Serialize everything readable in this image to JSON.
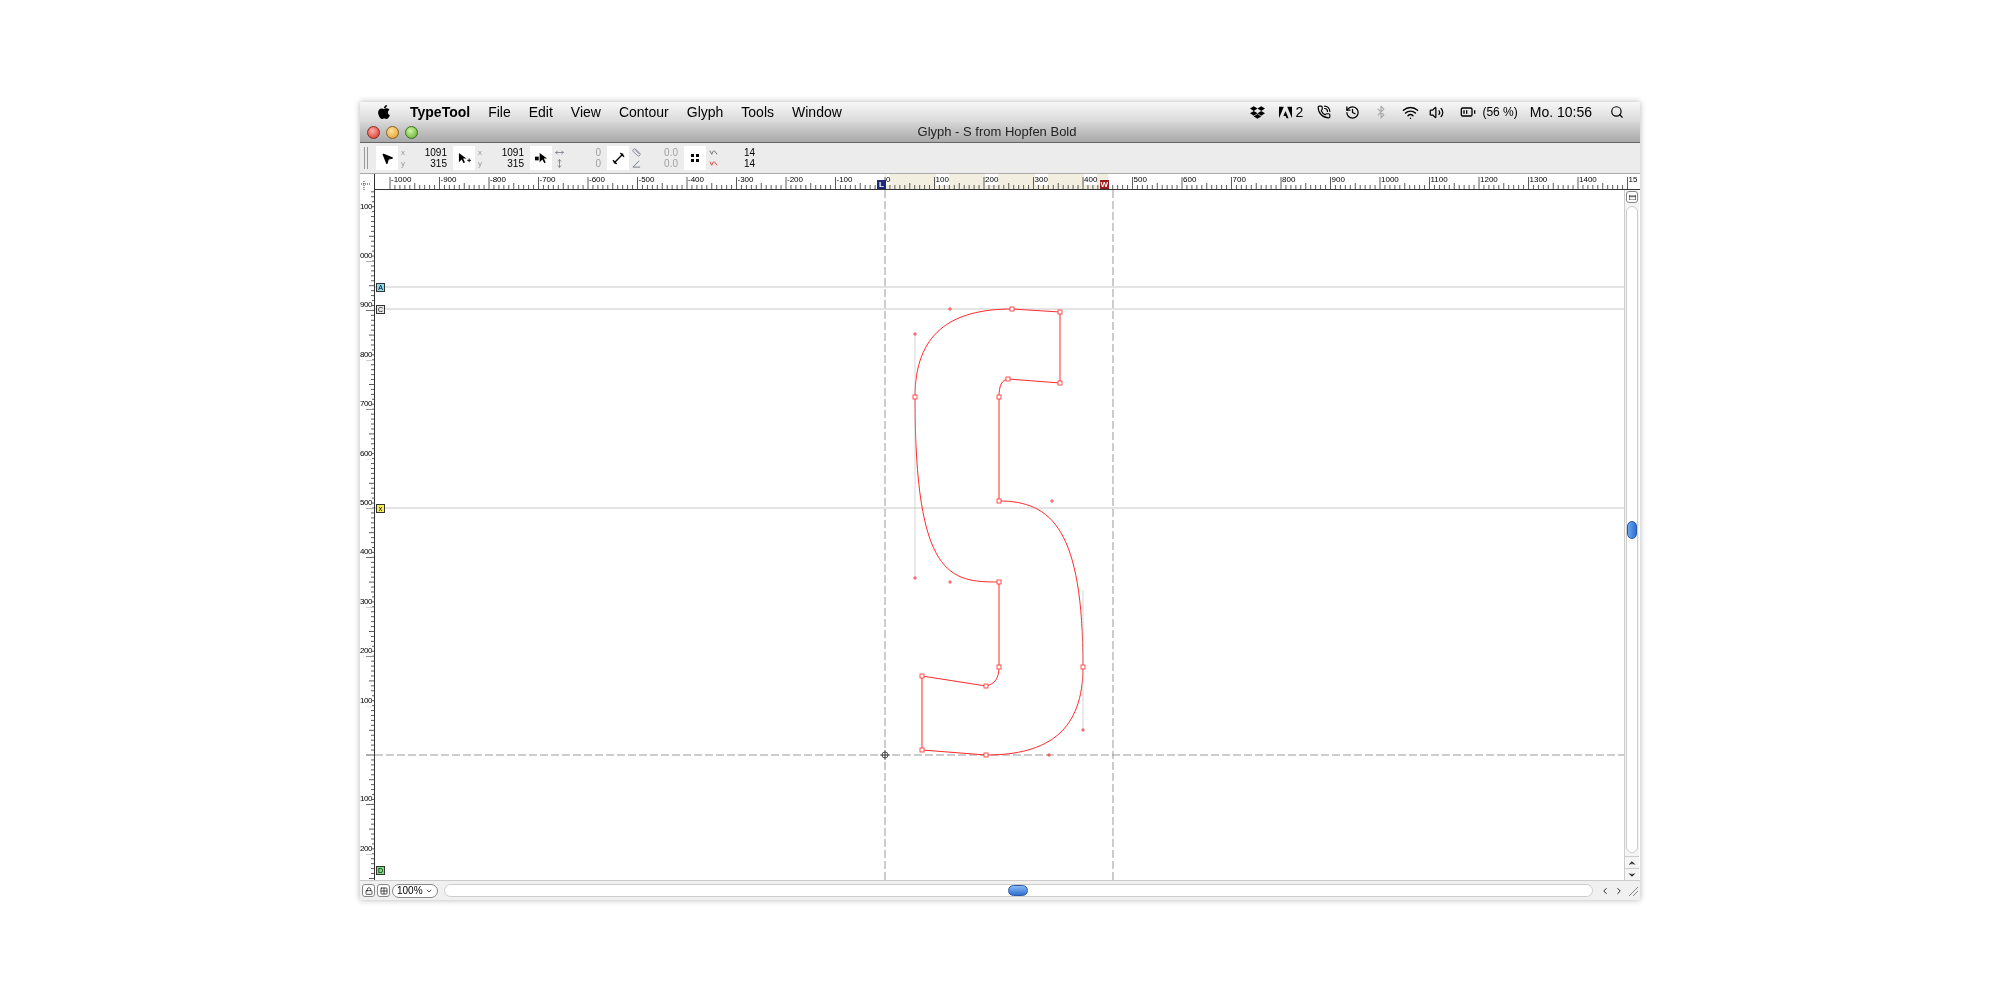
{
  "menu_bar": {
    "app_name": "TypeTool",
    "items": [
      "File",
      "Edit",
      "View",
      "Contour",
      "Glyph",
      "Tools",
      "Window"
    ],
    "status": {
      "adobe_count": "2",
      "bluetooth_enabled": false,
      "battery": "(56 %)",
      "clock": "Mo. 10:56"
    }
  },
  "window": {
    "title": "Glyph - S from Hopfen Bold"
  },
  "toolbar": {
    "groups": [
      {
        "kind": "pointer",
        "disabled": false,
        "rows": [
          {
            "label": "x",
            "value": "1091"
          },
          {
            "label": "y",
            "value": "315"
          }
        ]
      },
      {
        "kind": "pointer-plus",
        "disabled": false,
        "rows": [
          {
            "label": "x",
            "value": "1091"
          },
          {
            "label": "y",
            "value": "315"
          }
        ]
      },
      {
        "kind": "node-move",
        "disabled": true,
        "rows": [
          {
            "value": "0"
          },
          {
            "value": "0"
          }
        ]
      },
      {
        "kind": "measure",
        "disabled": true,
        "rows": [
          {
            "value": "0.0"
          },
          {
            "value": "0.0"
          }
        ]
      },
      {
        "kind": "grid",
        "disabled": false,
        "rows": [
          {
            "value": "14"
          },
          {
            "value": "14"
          }
        ]
      }
    ]
  },
  "rulers": {
    "horizontal_labels": [
      "-1000",
      "-900",
      "-800",
      "-700",
      "-600",
      "-500",
      "-400",
      "-300",
      "-200",
      "-100",
      "0",
      "100",
      "200",
      "300",
      "400",
      "500",
      "600",
      "700",
      "800",
      "900",
      "1000",
      "1100",
      "1200",
      "1300",
      "1400",
      "15"
    ],
    "vertical_labels": [
      "100",
      "000",
      "900",
      "800",
      "700",
      "600",
      "500",
      "400",
      "300",
      "200",
      "100",
      "100",
      "200"
    ],
    "horizontal_markers": [
      {
        "label": "L",
        "color": "#1f2a7a"
      },
      {
        "label": "W",
        "color": "#9a1c1c"
      }
    ],
    "vertical_markers": [
      {
        "label": "A",
        "color": "#8fd8f2"
      },
      {
        "label": "C",
        "color": "#e8e8e8"
      },
      {
        "label": "x",
        "color": "#f2ea5c"
      },
      {
        "label": "D",
        "color": "#7ee07e"
      }
    ]
  },
  "bottom_bar": {
    "zoom": "100%"
  }
}
